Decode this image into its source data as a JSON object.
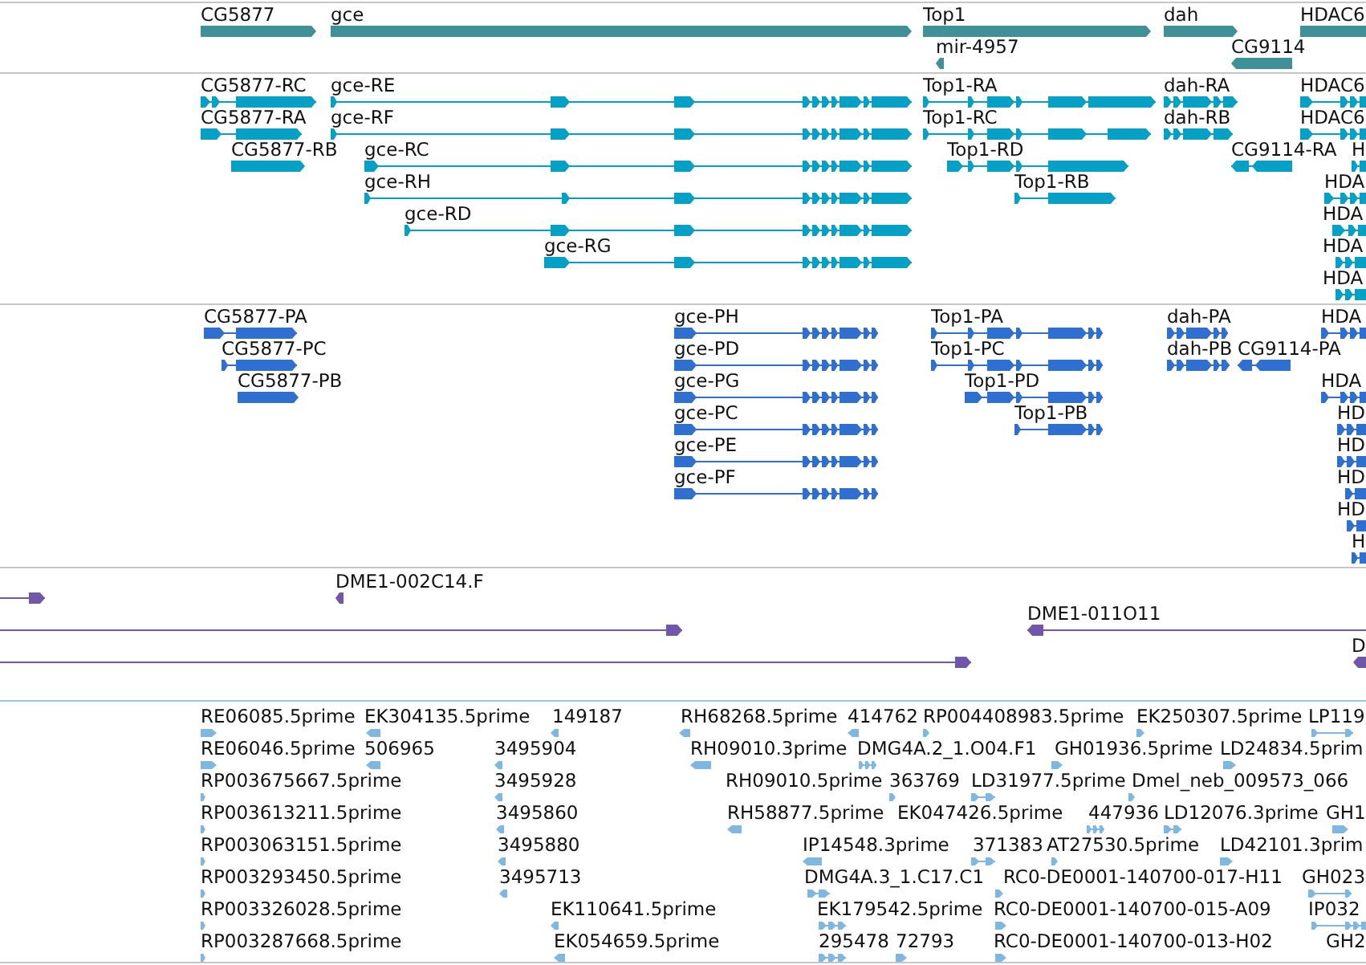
{
  "tracks": [
    {
      "kind": "gene",
      "features": [
        {
          "label": "CG5877",
          "reverse": false
        },
        {
          "label": "gce",
          "reverse": false
        },
        {
          "label": "Top1",
          "reverse": false
        },
        {
          "label": "dah",
          "reverse": false
        },
        {
          "label": "HDAC6",
          "reverse": false
        },
        {
          "label": "mir-4957",
          "reverse": true
        },
        {
          "label": "CG9114",
          "reverse": true
        }
      ]
    },
    {
      "kind": "transcript",
      "features": [
        {
          "label": "CG5877-RC",
          "reverse": false
        },
        {
          "label": "gce-RE",
          "reverse": false
        },
        {
          "label": "Top1-RA",
          "reverse": false
        },
        {
          "label": "dah-RA",
          "reverse": false
        },
        {
          "label": "HDAC6",
          "reverse": false
        },
        {
          "label": "CG5877-RA",
          "reverse": false
        },
        {
          "label": "gce-RF",
          "reverse": false
        },
        {
          "label": "Top1-RC",
          "reverse": false
        },
        {
          "label": "dah-RB",
          "reverse": false
        },
        {
          "label": "HDAC6",
          "reverse": false
        },
        {
          "label": "CG5877-RB",
          "reverse": false
        },
        {
          "label": "gce-RC",
          "reverse": false
        },
        {
          "label": "Top1-RD",
          "reverse": false
        },
        {
          "label": "CG9114-RA",
          "reverse": true
        },
        {
          "label": "H",
          "reverse": false
        },
        {
          "label": "gce-RH",
          "reverse": false
        },
        {
          "label": "Top1-RB",
          "reverse": false
        },
        {
          "label": "HDA",
          "reverse": false
        },
        {
          "label": "gce-RD",
          "reverse": false
        },
        {
          "label": "HDA",
          "reverse": false
        },
        {
          "label": "gce-RG",
          "reverse": false
        },
        {
          "label": "HDA",
          "reverse": false
        },
        {
          "label": "HDA",
          "reverse": false
        }
      ]
    },
    {
      "kind": "protein",
      "features": [
        {
          "label": "CG5877-PA",
          "reverse": false
        },
        {
          "label": "gce-PH",
          "reverse": false
        },
        {
          "label": "Top1-PA",
          "reverse": false
        },
        {
          "label": "dah-PA",
          "reverse": false
        },
        {
          "label": "HDA",
          "reverse": false
        },
        {
          "label": "CG5877-PC",
          "reverse": false
        },
        {
          "label": "gce-PD",
          "reverse": false
        },
        {
          "label": "Top1-PC",
          "reverse": false
        },
        {
          "label": "dah-PB",
          "reverse": false
        },
        {
          "label": "CG9114-PA",
          "reverse": true
        },
        {
          "label": "CG5877-PB",
          "reverse": false
        },
        {
          "label": "gce-PG",
          "reverse": false
        },
        {
          "label": "Top1-PD",
          "reverse": false
        },
        {
          "label": "HDA",
          "reverse": false
        },
        {
          "label": "gce-PC",
          "reverse": false
        },
        {
          "label": "Top1-PB",
          "reverse": false
        },
        {
          "label": "HD",
          "reverse": false
        },
        {
          "label": "gce-PE",
          "reverse": false
        },
        {
          "label": "HD",
          "reverse": false
        },
        {
          "label": "gce-PF",
          "reverse": false
        },
        {
          "label": "HD",
          "reverse": false
        },
        {
          "label": "HD",
          "reverse": false
        },
        {
          "label": "H",
          "reverse": false
        }
      ]
    },
    {
      "kind": "clone",
      "features": [
        {
          "reverse": false
        },
        {
          "label": "DME1-002C14.F",
          "reverse": true
        },
        {
          "reverse": false
        },
        {
          "label": "DME1-011O11",
          "reverse": true
        },
        {
          "reverse": false
        },
        {
          "label": "D",
          "reverse": true
        }
      ]
    },
    {
      "kind": "est",
      "features": [
        {
          "label": "RE06085.5prime",
          "reverse": false
        },
        {
          "label": "EK304135.5prime",
          "reverse": true
        },
        {
          "label": "149187",
          "reverse": true
        },
        {
          "label": "RH68268.5prime",
          "reverse": true
        },
        {
          "label": "414762",
          "reverse": true
        },
        {
          "label": "RP004408983.5prime",
          "reverse": false
        },
        {
          "label": "EK250307.5prime",
          "reverse": false
        },
        {
          "label": "LP119",
          "reverse": false
        },
        {
          "label": "RE06046.5prime",
          "reverse": false
        },
        {
          "label": "506965",
          "reverse": true
        },
        {
          "label": "3495904",
          "reverse": true
        },
        {
          "label": "RH09010.3prime",
          "reverse": true
        },
        {
          "label": "DMG4A.2_1.O04.F1",
          "reverse": false
        },
        {
          "label": "GH01936.5prime",
          "reverse": false
        },
        {
          "label": "LD24834.5prim",
          "reverse": false
        },
        {
          "label": "RP003675667.5prime",
          "reverse": false
        },
        {
          "label": "3495928",
          "reverse": true
        },
        {
          "label": "RH09010.5prime"
        },
        {
          "label": "363769",
          "reverse": false
        },
        {
          "label": "LD31977.5prime",
          "reverse": false
        },
        {
          "label": "Dmel_neb_009573_066",
          "reverse": false
        },
        {
          "label": "RP003613211.5prime",
          "reverse": false
        },
        {
          "label": "3495860",
          "reverse": true
        },
        {
          "label": "RH58877.5prime",
          "reverse": true
        },
        {
          "label": "EK047426.5prime"
        },
        {
          "label": "447936",
          "reverse": false
        },
        {
          "label": "LD12076.3prime",
          "reverse": false
        },
        {
          "label": "GH1",
          "reverse": false
        },
        {
          "label": "RP003063151.5prime",
          "reverse": false
        },
        {
          "label": "3495880",
          "reverse": true
        },
        {
          "label": "IP14548.3prime",
          "reverse": true
        },
        {
          "label": "371383",
          "reverse": false
        },
        {
          "label": "AT27530.5prime",
          "reverse": false
        },
        {
          "label": "LD42101.3prim",
          "reverse": false
        },
        {
          "label": "RP003293450.5prime",
          "reverse": false
        },
        {
          "label": "3495713",
          "reverse": true
        },
        {
          "label": "DMG4A.3_1.C17.C1",
          "reverse": false
        },
        {
          "label": "RC0-DE0001-140700-017-H11",
          "reverse": false
        },
        {
          "label": "GH023",
          "reverse": false
        },
        {
          "label": "RP003326028.5prime",
          "reverse": false
        },
        {
          "label": "EK110641.5prime",
          "reverse": true
        },
        {
          "label": "EK179542.5prime",
          "reverse": false
        },
        {
          "label": "RC0-DE0001-140700-015-A09",
          "reverse": false
        },
        {
          "label": "IP032",
          "reverse": false
        },
        {
          "label": "RP003287668.5prime",
          "reverse": false
        },
        {
          "label": "EK054659.5prime",
          "reverse": true
        },
        {
          "label": "295478",
          "reverse": false
        },
        {
          "label": "72793",
          "reverse": false
        },
        {
          "label": "RC0-DE0001-140700-013-H02",
          "reverse": false
        },
        {
          "label": "GH2"
        }
      ]
    }
  ]
}
